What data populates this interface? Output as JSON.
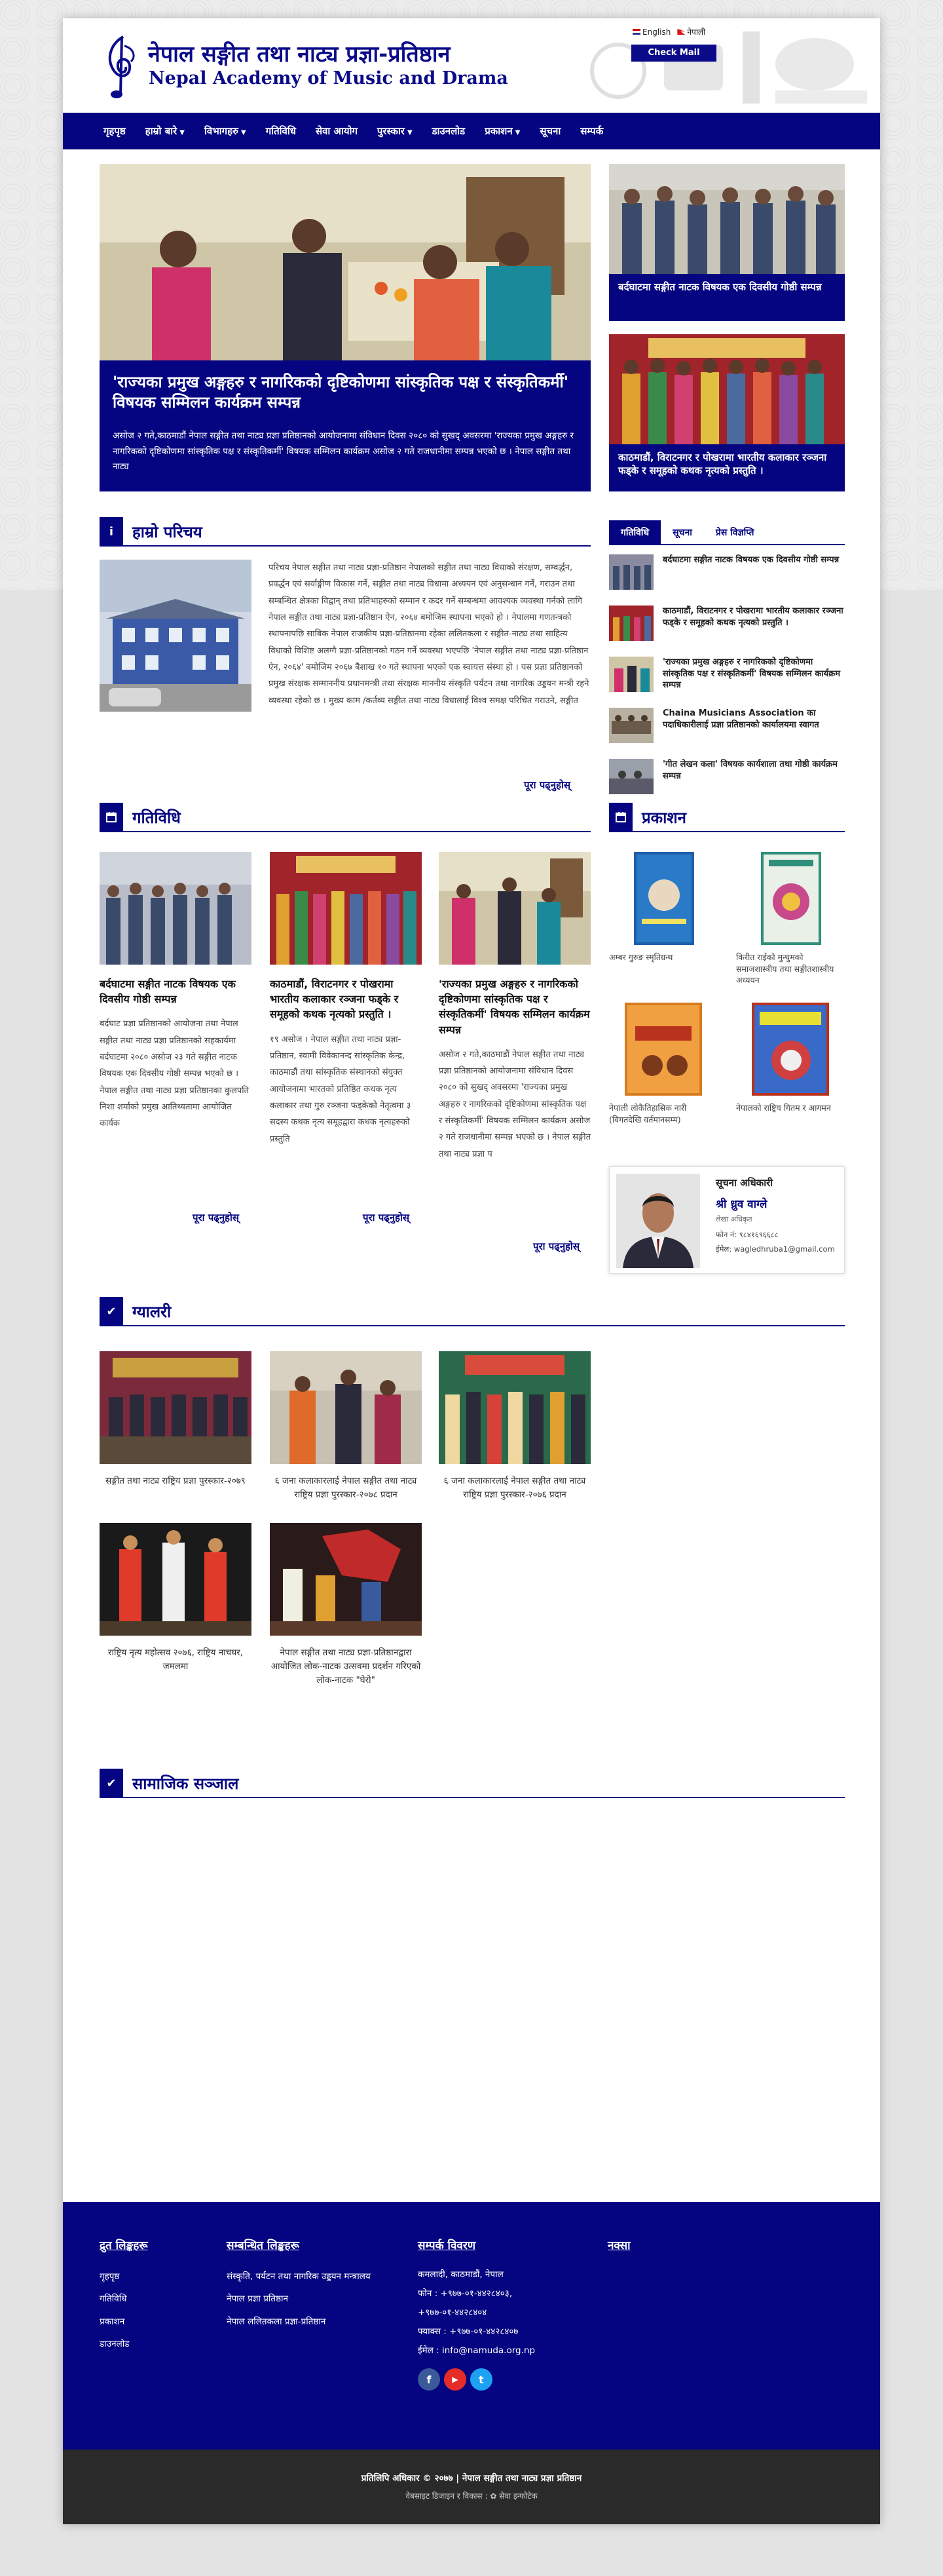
{
  "header": {
    "title_np": "नेपाल सङ्गीत तथा नाट्य प्रज्ञा-प्रतिष्ठान",
    "title_en": "Nepal Academy of Music and Drama",
    "lang_english": "English",
    "lang_nepali": "नेपाली",
    "check_mail": "Check Mail"
  },
  "nav": [
    {
      "label": "गृहपृष्ठ",
      "dropdown": false
    },
    {
      "label": "हाम्रो बारे",
      "dropdown": true
    },
    {
      "label": "विभागहरु",
      "dropdown": true
    },
    {
      "label": "गतिविधि",
      "dropdown": false
    },
    {
      "label": "सेवा आयोग",
      "dropdown": false
    },
    {
      "label": "पुरस्कार",
      "dropdown": true
    },
    {
      "label": "डाउनलोड",
      "dropdown": false
    },
    {
      "label": "प्रकाशन",
      "dropdown": true
    },
    {
      "label": "सूचना",
      "dropdown": false
    },
    {
      "label": "सम्पर्क",
      "dropdown": false
    }
  ],
  "hero": {
    "title": "'राज्यका प्रमुख अङ्गहरु र नागरिकको दृष्टिकोणमा सांस्कृतिक पक्ष र संस्कृतिकर्मी' विषयक सम्मिलन कार्यक्रम सम्पन्न",
    "text": "असोज २ गते,काठमाडौं नेपाल सङ्गीत तथा नाट्य प्रज्ञा प्रतिष्ठानको आयोजनामा संविधान दिवस २०८० को सुखद् अवसरमा 'राज्यका प्रमुख अङ्गहरु र नागरिकको दृष्टिकोणमा सांस्कृतिक पक्ष र संस्कृतिकर्मी' विषयक सम्मिलन कार्यक्रम असोज २ गते राजधानीमा सम्पन्न भएको छ । नेपाल सङ्गीत तथा नाट्य"
  },
  "side_cards": [
    {
      "caption": "बर्दघाटमा सङ्गीत नाटक विषयक एक दिवसीय गोष्ठी सम्पन्न"
    },
    {
      "caption": "काठमाडौं, विराटनगर र पोखरामा भारतीय कलाकार रञ्जना फड्के र समूहको कथक नृत्यको प्रस्तुति ।"
    }
  ],
  "about": {
    "heading": "हाम्रो परिचय",
    "icon": "i",
    "text": "परिचय नेपाल सङ्गीत तथा नाट्य प्रज्ञा-प्रतिष्ठान नेपालको सङ्गीत तथा नाट्य विधाको संरक्षण, सम्वर्द्धन, प्रवर्द्धन एवं सर्वाङ्गीण विकास गर्ने, सङ्गीत तथा नाट्य विधामा अध्ययन एवं अनुसन्धान गर्ने, गराउन तथा सम्बन्धित क्षेत्रका विद्वान् तथा प्रतिभाहरुको सम्मान र कदर गर्ने सम्बन्धमा आवश्यक व्यवस्था गर्नको लागि नेपाल सङ्गीत तथा नाट्य प्रज्ञा-प्रतिष्ठान ऐन, २०६४ बमोजिम स्थापना भएको हो । नेपालमा गणतन्त्रको स्थापनापछि साबिक नेपाल राजकीय प्रज्ञा-प्रतिष्ठानमा रहेका ललितकला र सङ्गीत-नाट्य तथा साहित्य विधाको विशिष्ट अलग्गै प्रज्ञा-प्रतिष्ठानको गठन गर्ने व्यवस्था भएपछि 'नेपाल सङ्गीत तथा नाट्य प्रज्ञा-प्रतिष्ठान ऐन, २०६४' बमोजिम २०६७ बैशाख १० गते स्थापना भएको एक स्वायत्त संस्था हो । यस प्रज्ञा प्रतिष्ठानको प्रमुख संरक्षक सम्माननीय प्रधानमन्त्री तथा संरक्षक माननीय संस्कृति पर्यटन तथा नागरिक उड्डयन मन्त्री रहने व्यवस्था रहेको छ । मुख्य काम /कर्तव्य सङ्गीत तथा नाट्य विधालाई विश्व समक्ष परिचित गराउने, सङ्गीत",
    "read_more": "पूरा पढ्नुहोस्"
  },
  "tabs": [
    "गतिविधि",
    "सूचना",
    "प्रेस विज्ञप्ति"
  ],
  "news": [
    {
      "title": "बर्दघाटमा सङ्गीत नाटक विषयक एक दिवसीय गोष्ठी सम्पन्न"
    },
    {
      "title": "काठमाडौं, विराटनगर र पोखरामा भारतीय कलाकार रञ्जना फड्के र समूहको कथक नृत्यको प्रस्तुति ।"
    },
    {
      "title": "'राज्यका प्रमुख अङ्गहरु र नागरिकको दृष्टिकोणमा सांस्कृतिक पक्ष र संस्कृतिकर्मी' विषयक सम्मिलन कार्यक्रम सम्पन्न"
    },
    {
      "title": "Chaina Musicians Association का पदाधिकारीलाई प्रज्ञा प्रतिष्ठानको कार्यालयमा स्वागत"
    },
    {
      "title": "'गीत लेखन कला' विषयक कार्यशाला तथा गोष्ठी कार्यक्रम सम्पन्न"
    }
  ],
  "activities": {
    "heading": "गतिविधि",
    "items": [
      {
        "title": "बर्दघाटमा सङ्गीत नाटक विषयक एक दिवसीय गोष्ठी सम्पन्न",
        "text": "बर्दघाट प्रज्ञा प्रतिष्ठानको आयोजना तथा नेपाल सङ्गीत तथा नाट्य प्रज्ञा प्रतिष्ठानको सहकार्यमा बर्दघाटमा २०८० असोज २३ गते सङ्गीत नाटक विषयक एक दिवसीय गोष्ठी सम्पन्न भएको छ । नेपाल सङ्गीत तथा नाट्य प्रज्ञा प्रतिष्ठानका कुलपति निशा शर्माको प्रमुख आतिथ्यतामा आयोजित कार्यक",
        "read_more": "पूरा पढ्नुहोस्"
      },
      {
        "title": "काठमाडौं, विराटनगर र पोखरामा भारतीय कलाकार रञ्जना फड्के र समूहको कथक नृत्यको प्रस्तुति ।",
        "text": "१९ असोज । नेपाल सङ्गीत तथा नाट्य प्रज्ञा-प्रतिष्ठान, स्वामी विवेकानन्द सांस्कृतिक केन्द्र, काठमाडौं तथा सांस्कृतिक संस्थानको संयुक्त आयोजनामा भारतको प्रतिष्ठित कथक नृत्य कलाकार तथा गुरु रञ्जना फड्केको नेतृत्वमा ३ सदस्य कथक नृत्य समूहद्वारा कथक नृत्यहरुको प्रस्तुति",
        "read_more": "पूरा पढ्नुहोस्"
      },
      {
        "title": "'राज्यका प्रमुख अङ्गहरु र नागरिकको दृष्टिकोणमा सांस्कृतिक पक्ष र संस्कृतिकर्मी' विषयक सम्मिलन कार्यक्रम सम्पन्न",
        "text": "असोज २ गते,काठमाडौं नेपाल सङ्गीत तथा नाट्य प्रज्ञा प्रतिष्ठानको आयोजनामा संविधान दिवस २०८० को सुखद् अवसरमा 'राज्यका प्रमुख अङ्गहरु र नागरिकको दृष्टिकोणमा सांस्कृतिक पक्ष र संस्कृतिकर्मी' विषयक सम्मिलन कार्यक्रम असोज २ गते राजधानीमा सम्पन्न भएको छ । नेपाल सङ्गीत तथा नाट्य प्रज्ञा प",
        "read_more": "पूरा पढ्नुहोस्"
      }
    ]
  },
  "publications": {
    "heading": "प्रकाशन",
    "items": [
      {
        "caption": "अम्बर गुरुङ स्मृतिग्रन्थ",
        "color": "#1d5fa8"
      },
      {
        "caption": "किरीत राईको मुन्धुमको समाजशास्त्रीय तथा सङ्गीतशास्त्रीय अध्ययन",
        "color": "#2f8f7a"
      },
      {
        "caption": "नेपाली लोकैतिहासिक नारी (विगतदेखि वर्तमानसम्म)",
        "color": "#d87b1f"
      },
      {
        "caption": "नेपालको राष्ट्रिय गितम र आगमन",
        "color": "#b8321e"
      }
    ]
  },
  "info_officer": {
    "label": "सूचना अधिकारी",
    "name": "श्री ध्रुव वाग्ले",
    "role": "लेखा अधिकृत",
    "phone": "फोन नं: ९८४१६९६६८८",
    "email": "ईमेल: wagledhruba1@gmail.com"
  },
  "gallery": {
    "heading": "ग्यालरी",
    "items": [
      {
        "caption": "सङ्गीत तथा नाट्य राष्ट्रिय प्रज्ञा पुरस्कार-२०७९"
      },
      {
        "caption": "६ जना कलाकारलाई नेपाल सङ्गीत तथा नाट्य राष्ट्रिय प्रज्ञा पुरस्कार-२०७८ प्रदान"
      },
      {
        "caption": "६ जना कलाकारलाई नेपाल सङ्गीत तथा नाट्य राष्ट्रिय प्रज्ञा पुरस्कार-२०७६ प्रदान"
      },
      {
        "caption": "राष्ट्रिय नृत्य महोत्सव २०७६, राष्ट्रिय नाचघर, जमलमा"
      },
      {
        "caption": "नेपाल सङ्गीत तथा नाट्य प्रज्ञा-प्रतिष्ठानद्वारा आयोजित लोक-नाटक उत्सवमा प्रदर्शन गरिएको लोक-नाटक \"घेरो\""
      }
    ]
  },
  "social_section": {
    "heading": "सामाजिक सञ्जाल"
  },
  "footer": {
    "quick_links_head": "द्रुत लिङ्कहरू",
    "quick_links": [
      "गृहपृष्ठ",
      "गतिविधि",
      "प्रकाशन",
      "डाउनलोड"
    ],
    "related_links_head": "सम्बन्धित लिङ्कहरू",
    "related_links": [
      "संस्कृति, पर्यटन तथा नागरिक उड्डयन मन्त्रालय",
      "नेपाल प्रज्ञा प्रतिष्ठान",
      "नेपाल ललितकला प्रज्ञा-प्रतिष्ठान"
    ],
    "contact_head": "सम्पर्क विवरण",
    "contact_lines": [
      "कमलादी, काठमाडौं, नेपाल",
      "फोन : +९७७-०१-४४२८४०३,",
      "+९७७-०१-४४२८४०४",
      "फ्याक्स : +९७७-०१-४४२८४०७",
      "ईमेल : info@namuda.org.np"
    ],
    "map_head": "नक्सा",
    "social": [
      {
        "icon": "facebook-icon",
        "glyph": "f",
        "color": "#3b5998"
      },
      {
        "icon": "youtube-icon",
        "glyph": "▶",
        "color": "#e52d27"
      },
      {
        "icon": "twitter-icon",
        "glyph": "t",
        "color": "#1da1f2"
      }
    ]
  },
  "copyright": {
    "line1": "प्रतिलिपि अधिकार © २०७७ | नेपाल सङ्गीत तथा नाट्य प्रज्ञा प्रतिष्ठान",
    "line2": "वेबसाइट डिजाइन र विकास : ✿ सेवा इन्फोटेक"
  },
  "colors": {
    "brand": "#050581",
    "footer_bottom": "#2a2a2a"
  }
}
